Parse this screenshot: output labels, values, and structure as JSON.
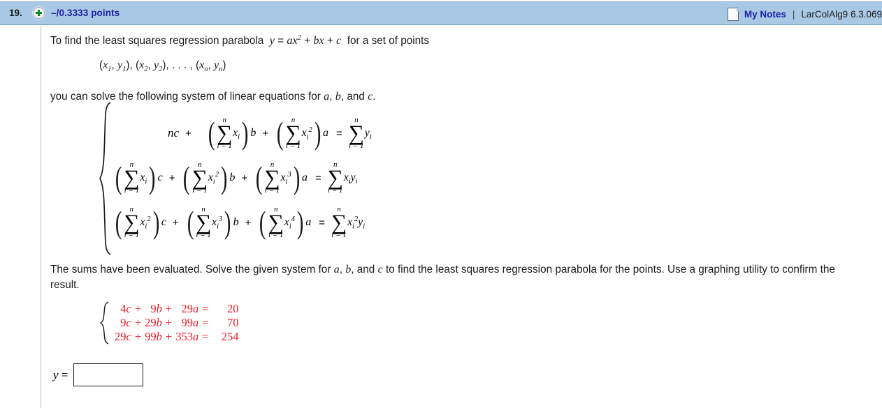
{
  "header": {
    "question_number": "19.",
    "expand_icon": "plus-circle-icon",
    "points": "–/0.3333 points",
    "notes_icon": "note-page-icon",
    "my_notes_label": "My Notes",
    "separator": "|",
    "course_code": "LarColAlg9 6.3.069",
    "background_color": "#a9c8e4",
    "link_color": "#1b23a8"
  },
  "content": {
    "intro_line_1_pre": "To find the least squares regression parabola",
    "intro_line_1_formula": "y = ax2 + bx + c",
    "intro_line_1_post": "for a set of points",
    "points_line": "(x1, y1), (x2, y2), . . . , (xn, yn)",
    "intro_line_2": "you can solve the following system of linear equations for a, b, and c.",
    "instruction": "The sums have been evaluated. Solve the given system for a, b, and c to find the least squares regression parabola for the points. Use a graphing utility to confirm the result."
  },
  "symbolic_system": {
    "index_top": "n",
    "index_bottom": "i = 1",
    "rows": [
      {
        "lead_term": "nc",
        "op1": "+",
        "term1_summand": "xi",
        "term1_coef": "b",
        "op2": "+",
        "term2_summand": "xi2",
        "term2_coef": "a",
        "equals": "=",
        "rhs_summand": "yi"
      },
      {
        "term0_summand": "xi",
        "term0_coef": "c",
        "op1": "+",
        "term1_summand": "xi2",
        "term1_coef": "b",
        "op2": "+",
        "term2_summand": "xi3",
        "term2_coef": "a",
        "equals": "=",
        "rhs_summand": "xiyi"
      },
      {
        "term0_summand": "xi2",
        "term0_coef": "c",
        "op1": "+",
        "term1_summand": "xi3",
        "term1_coef": "b",
        "op2": "+",
        "term2_summand": "xi4",
        "term2_coef": "a",
        "equals": "=",
        "rhs_summand": "xi2yi"
      }
    ]
  },
  "numeric_system": {
    "color": "#e8202a",
    "rows": [
      {
        "c": "4",
        "cv": "c",
        "op1": "+",
        "b": "9",
        "bv": "b",
        "op2": "+",
        "a": "29",
        "av": "a",
        "eq": "=",
        "rhs": "20"
      },
      {
        "c": "9",
        "cv": "c",
        "op1": "+",
        "b": "29",
        "bv": "b",
        "op2": "+",
        "a": "99",
        "av": "a",
        "eq": "=",
        "rhs": "70"
      },
      {
        "c": "29",
        "cv": "c",
        "op1": "+",
        "b": "99",
        "bv": "b",
        "op2": "+",
        "a": "353",
        "av": "a",
        "eq": "=",
        "rhs": "254"
      }
    ]
  },
  "answer": {
    "label_var": "y",
    "label_eq": "=",
    "value": "",
    "placeholder": ""
  }
}
